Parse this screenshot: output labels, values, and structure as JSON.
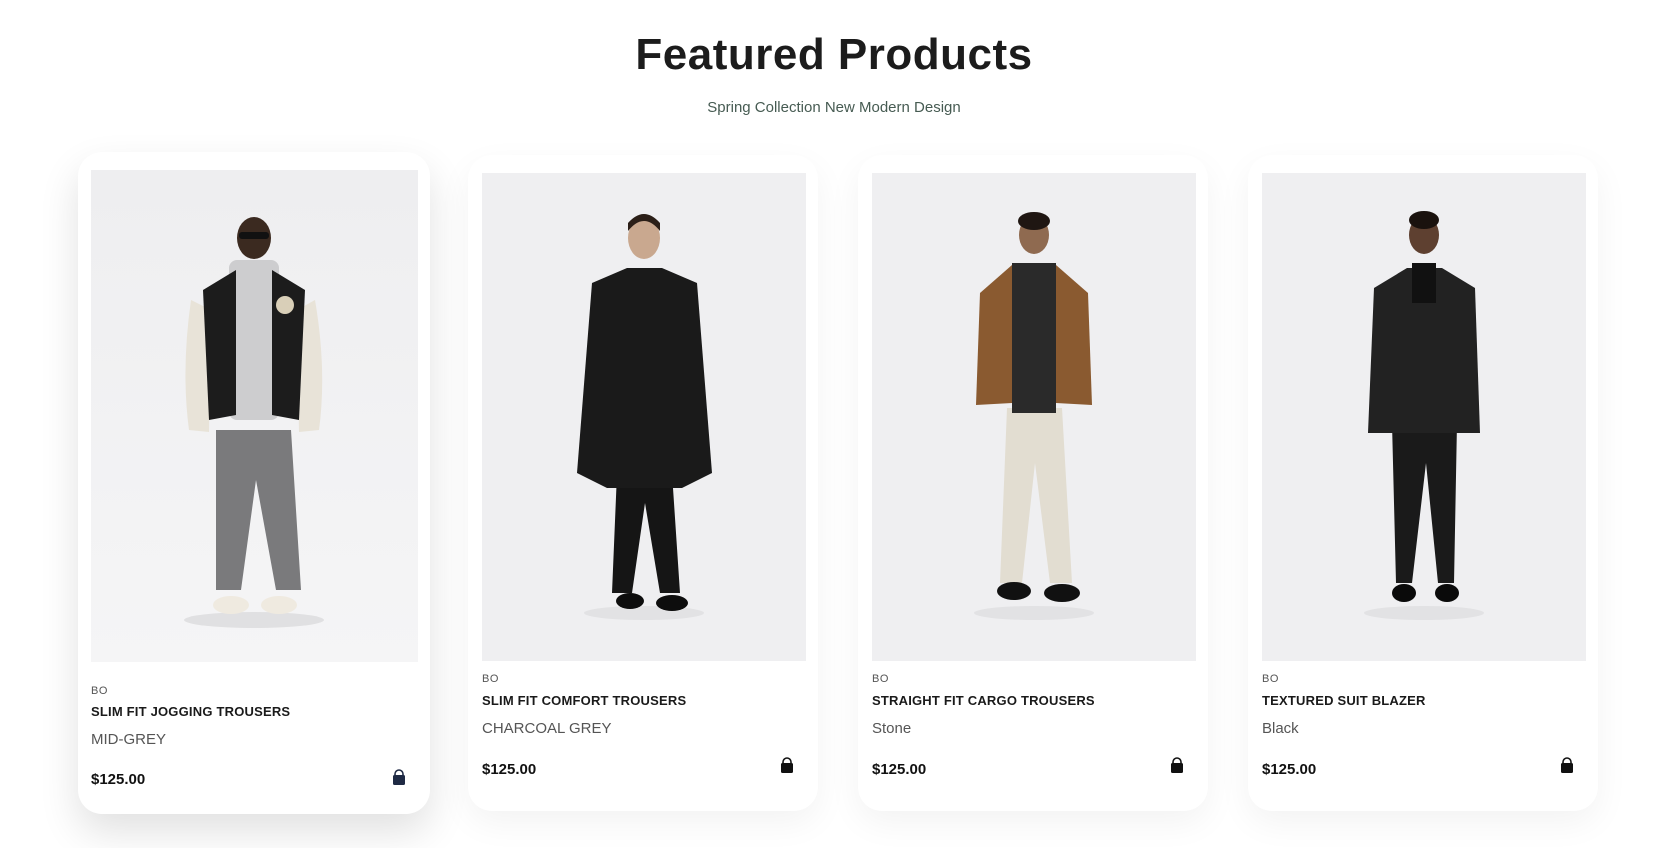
{
  "section": {
    "title": "Featured Products",
    "subtitle": "Spring Collection New Modern Design"
  },
  "products": [
    {
      "brand": "BO",
      "name": "SLIM FIT JOGGING TROUSERS",
      "color": "MID-GREY",
      "price": "$125.00",
      "cart_icon": "shopping-bag-icon",
      "active": true,
      "image": "model in black varsity jacket with cream sleeves, grey hoodie and grey jogging trousers"
    },
    {
      "brand": "BO",
      "name": "SLIM FIT COMFORT TROUSERS",
      "color": "CHARCOAL GREY",
      "price": "$125.00",
      "cart_icon": "shopping-bag-icon",
      "active": false,
      "image": "model in long black coat and black trousers"
    },
    {
      "brand": "BO",
      "name": "STRAIGHT FIT CARGO TROUSERS",
      "color": "Stone",
      "price": "$125.00",
      "cart_icon": "shopping-bag-icon",
      "active": false,
      "image": "model in brown suede jacket and stone cargo trousers"
    },
    {
      "brand": "BO",
      "name": "TEXTURED SUIT BLAZER",
      "color": "Black",
      "price": "$125.00",
      "cart_icon": "shopping-bag-icon",
      "active": false,
      "image": "model in black suit blazer and black trousers"
    }
  ],
  "colors": {
    "image_bg": "#efeff1",
    "title": "#1c1c1c",
    "subtitle": "#465b52",
    "bag_icon": "#1f2a44"
  }
}
